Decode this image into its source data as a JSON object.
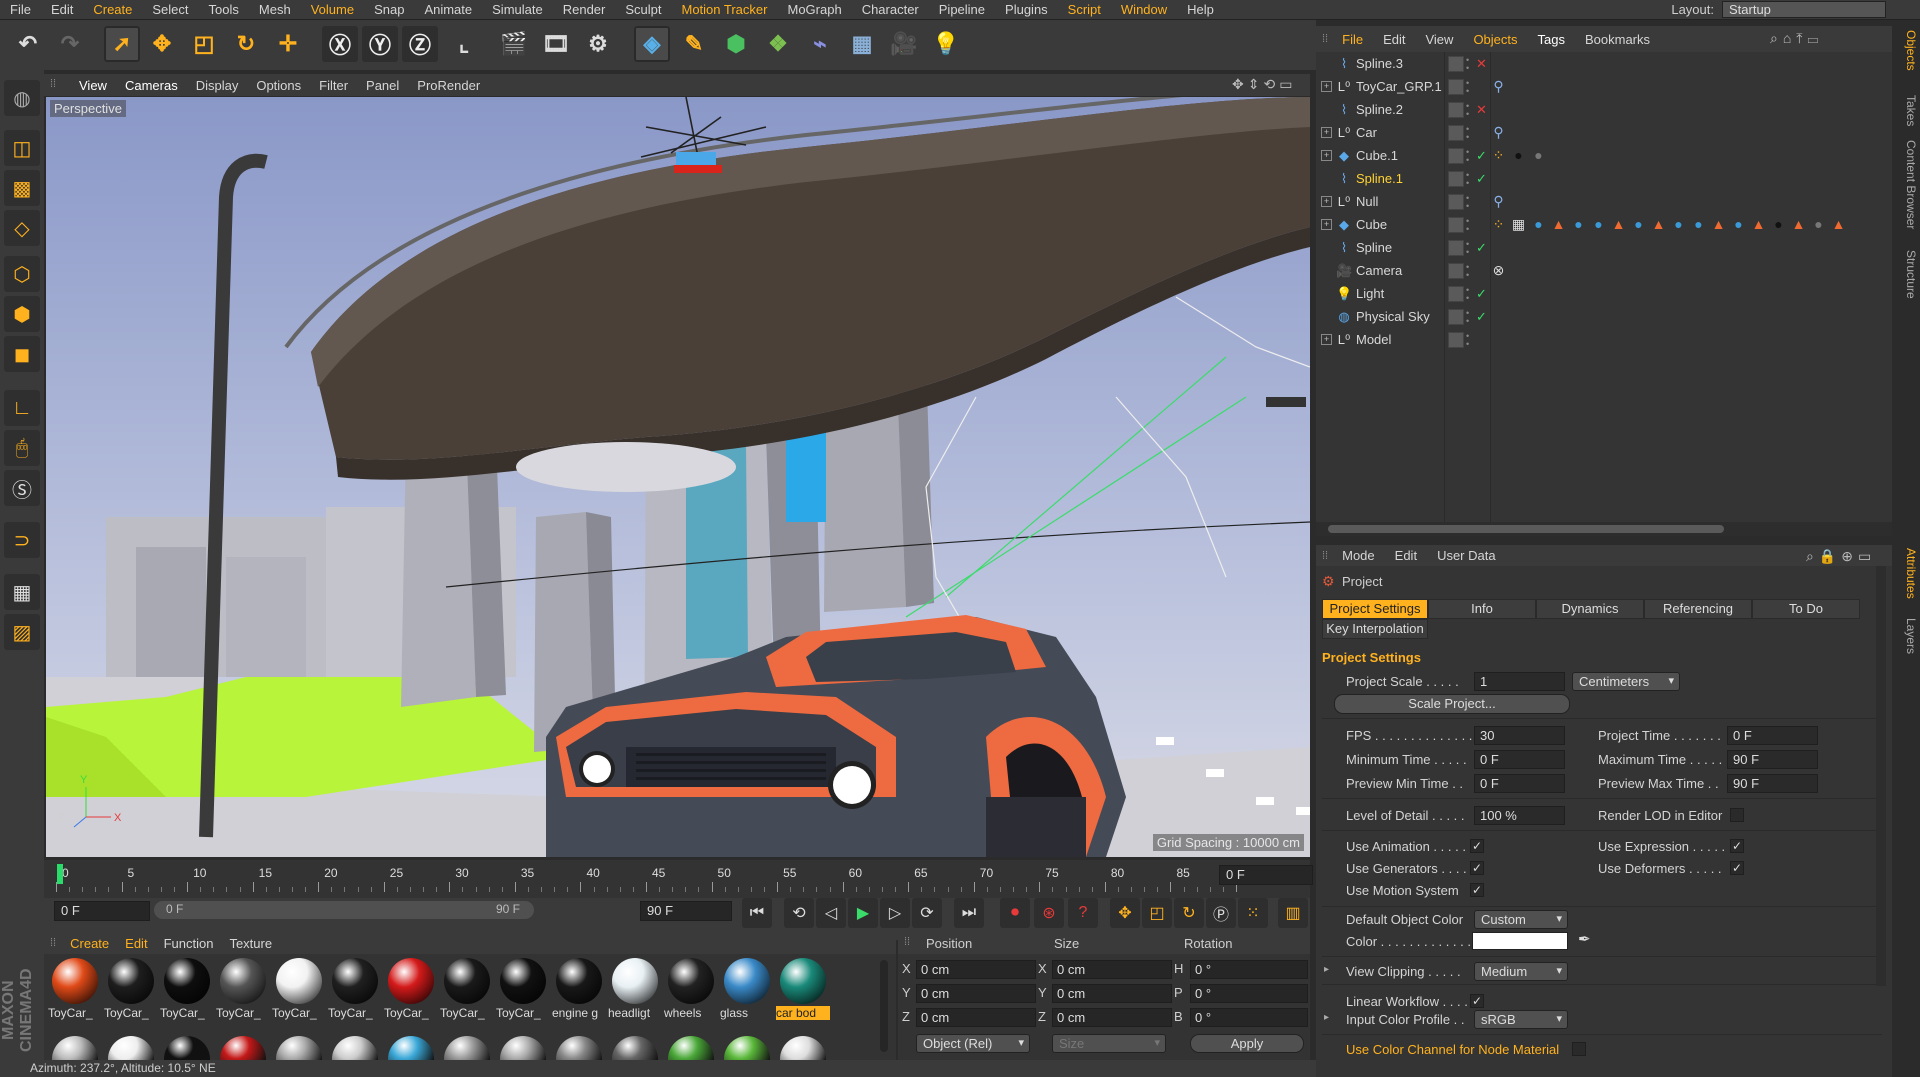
{
  "menubar": {
    "items": [
      "File",
      "Edit",
      "Create",
      "Select",
      "Tools",
      "Mesh",
      "Volume",
      "Snap",
      "Animate",
      "Simulate",
      "Render",
      "Sculpt",
      "Motion Tracker",
      "MoGraph",
      "Character",
      "Pipeline",
      "Plugins",
      "Script",
      "Window",
      "Help"
    ],
    "layout_label": "Layout:",
    "layout_value": "Startup"
  },
  "viewport": {
    "menu": [
      "View",
      "Cameras",
      "Display",
      "Options",
      "Filter",
      "Panel",
      "ProRender"
    ],
    "label": "Perspective",
    "grid_spacing": "Grid Spacing : 10000 cm",
    "axis_labels": [
      "Y",
      "Z",
      "X"
    ]
  },
  "timeline": {
    "ticks": [
      "0",
      "5",
      "10",
      "15",
      "20",
      "25",
      "30",
      "35",
      "40",
      "45",
      "50",
      "55",
      "60",
      "65",
      "70",
      "75",
      "80",
      "85",
      "90"
    ],
    "current_frame_display": "0 F",
    "start_field": "0 F",
    "range_start": "0 F",
    "range_end": "90 F",
    "end_field": "90 F",
    "playhead_fraction": 0.0
  },
  "material_manager": {
    "menu": [
      "Create",
      "Edit",
      "Function",
      "Texture"
    ],
    "materials": [
      {
        "label": "ToyCar_",
        "color": "#e04a18"
      },
      {
        "label": "ToyCar_",
        "color": "#1e1e1e"
      },
      {
        "label": "ToyCar_",
        "color": "#0e0e0e"
      },
      {
        "label": "ToyCar_",
        "color": "#555555"
      },
      {
        "label": "ToyCar_",
        "color": "#f2f2f2"
      },
      {
        "label": "ToyCar_",
        "color": "#202020"
      },
      {
        "label": "ToyCar_",
        "color": "#d41a1a"
      },
      {
        "label": "ToyCar_",
        "color": "#1a1a1a"
      },
      {
        "label": "ToyCar_",
        "color": "#111111"
      },
      {
        "label": "engine g",
        "color": "#181818"
      },
      {
        "label": "headligt",
        "color": "#e8f0f4"
      },
      {
        "label": "wheels",
        "color": "#222222"
      },
      {
        "label": "glass",
        "color": "#3a8ac8"
      },
      {
        "label": "car bod",
        "color": "#1a8a7a"
      }
    ],
    "row2_colors": [
      "#bbbbbb",
      "#eeeeee",
      "#111111",
      "#c41818",
      "#aaaaaa",
      "#cccccc",
      "#3aa8d8",
      "#999999",
      "#aaaaaa",
      "#888888",
      "#666666",
      "#4aa838",
      "#5ab83a",
      "#dddddd"
    ]
  },
  "coordinates": {
    "headers": [
      "Position",
      "Size",
      "Rotation"
    ],
    "rows": [
      {
        "axis": "X",
        "pos": "0 cm",
        "size_axis": "X",
        "size": "0 cm",
        "rot_axis": "H",
        "rot": "0 °"
      },
      {
        "axis": "Y",
        "pos": "0 cm",
        "size_axis": "Y",
        "size": "0 cm",
        "rot_axis": "P",
        "rot": "0 °"
      },
      {
        "axis": "Z",
        "pos": "0 cm",
        "size_axis": "Z",
        "size": "0 cm",
        "rot_axis": "B",
        "rot": "0 °"
      }
    ],
    "mode_dropdown": "Object (Rel)",
    "size_dropdown": "Size",
    "apply_label": "Apply"
  },
  "status": {
    "text": "Azimuth: 237.2°, Altitude: 10.5°  NE"
  },
  "objects_manager": {
    "menu": [
      "File",
      "Edit",
      "View",
      "Objects",
      "Tags",
      "Bookmarks"
    ],
    "objects": [
      {
        "name": "Spline.3",
        "icon": "spline-icon",
        "expand": false,
        "highlight": false,
        "status": "x",
        "tags": []
      },
      {
        "name": "ToyCar_GRP.1",
        "icon": "null-icon",
        "expand": true,
        "highlight": false,
        "status": "",
        "tags": [
          "protection"
        ]
      },
      {
        "name": "Spline.2",
        "icon": "spline-icon",
        "expand": false,
        "highlight": false,
        "status": "x",
        "tags": []
      },
      {
        "name": "Car",
        "icon": "null-icon",
        "expand": true,
        "highlight": false,
        "status": "",
        "tags": [
          "protection"
        ]
      },
      {
        "name": "Cube.1",
        "icon": "cube-icon",
        "expand": true,
        "highlight": false,
        "status": "check",
        "tags": [
          "phong",
          "black-ball",
          "gray-ball"
        ]
      },
      {
        "name": "Spline.1",
        "icon": "spline-icon",
        "expand": false,
        "highlight": true,
        "status": "check",
        "tags": []
      },
      {
        "name": "Null",
        "icon": "null-icon",
        "expand": true,
        "highlight": false,
        "status": "",
        "tags": [
          "protection"
        ]
      },
      {
        "name": "Cube",
        "icon": "cube-icon",
        "expand": true,
        "highlight": false,
        "status": "",
        "tags": [
          "phong",
          "checker",
          "blue",
          "orange-tri",
          "blue",
          "blue",
          "orange-tri",
          "blue",
          "orange-tri",
          "blue",
          "blue",
          "orange-tri",
          "blue",
          "orange-tri",
          "black-ball",
          "orange-tri",
          "gray-ball",
          "orange-tri"
        ]
      },
      {
        "name": "Spline",
        "icon": "spline-icon",
        "expand": false,
        "highlight": false,
        "status": "check",
        "tags": []
      },
      {
        "name": "Camera",
        "icon": "camera-icon",
        "expand": false,
        "highlight": false,
        "status": "",
        "tags": [
          "target"
        ]
      },
      {
        "name": "Light",
        "icon": "light-icon",
        "expand": false,
        "highlight": false,
        "status": "check",
        "tags": []
      },
      {
        "name": "Physical Sky",
        "icon": "sky-icon",
        "expand": false,
        "highlight": false,
        "status": "check",
        "tags": []
      },
      {
        "name": "Model",
        "icon": "null-icon",
        "expand": true,
        "highlight": false,
        "status": "",
        "tags": []
      }
    ]
  },
  "attributes": {
    "menu": [
      "Mode",
      "Edit",
      "User Data"
    ],
    "title": "Project",
    "tabs": [
      "Project Settings",
      "Info",
      "Dynamics",
      "Referencing",
      "To Do"
    ],
    "tab2": [
      "Key Interpolation"
    ],
    "section": "Project Settings",
    "project_scale_label": "Project Scale . . . . .",
    "project_scale_value": "1",
    "project_scale_unit": "Centimeters",
    "scale_button": "Scale Project...",
    "fps_label": "FPS . . . . . . . . . . . . . .",
    "fps_value": "30",
    "project_time_label": "Project Time . . . . . . .",
    "project_time_value": "0 F",
    "min_time_label": "Minimum Time . . . . .",
    "min_time_value": "0 F",
    "max_time_label": "Maximum Time . . . . .",
    "max_time_value": "90 F",
    "preview_min_label": "Preview Min Time . .",
    "preview_min_value": "0 F",
    "preview_max_label": "Preview Max Time . .",
    "preview_max_value": "90 F",
    "lod_label": "Level of Detail . . . . .",
    "lod_value": "100 %",
    "render_lod_label": "Render LOD in Editor",
    "use_animation_label": "Use Animation . . . . .",
    "use_expression_label": "Use Expression . . . . .",
    "use_generators_label": "Use Generators . . . .",
    "use_deformers_label": "Use Deformers . . . . .",
    "use_motion_label": "Use Motion System",
    "default_color_label": "Default Object Color",
    "default_color_value": "Custom",
    "color_label": "Color . . . . . . . . . . . . .",
    "view_clipping_label": "View Clipping . . . . .",
    "view_clipping_value": "Medium",
    "linear_workflow_label": "Linear Workflow . . . .",
    "input_color_label": "Input Color Profile . .",
    "input_color_value": "sRGB",
    "node_material_label": "Use Color Channel for Node Material"
  },
  "right_tabs": [
    "Objects",
    "Takes",
    "Content Browser",
    "Structure",
    "Attributes",
    "Layers"
  ],
  "colors": {
    "accent": "#ffb21e",
    "panel": "#343434",
    "toolbar": "#3a3a3a"
  }
}
